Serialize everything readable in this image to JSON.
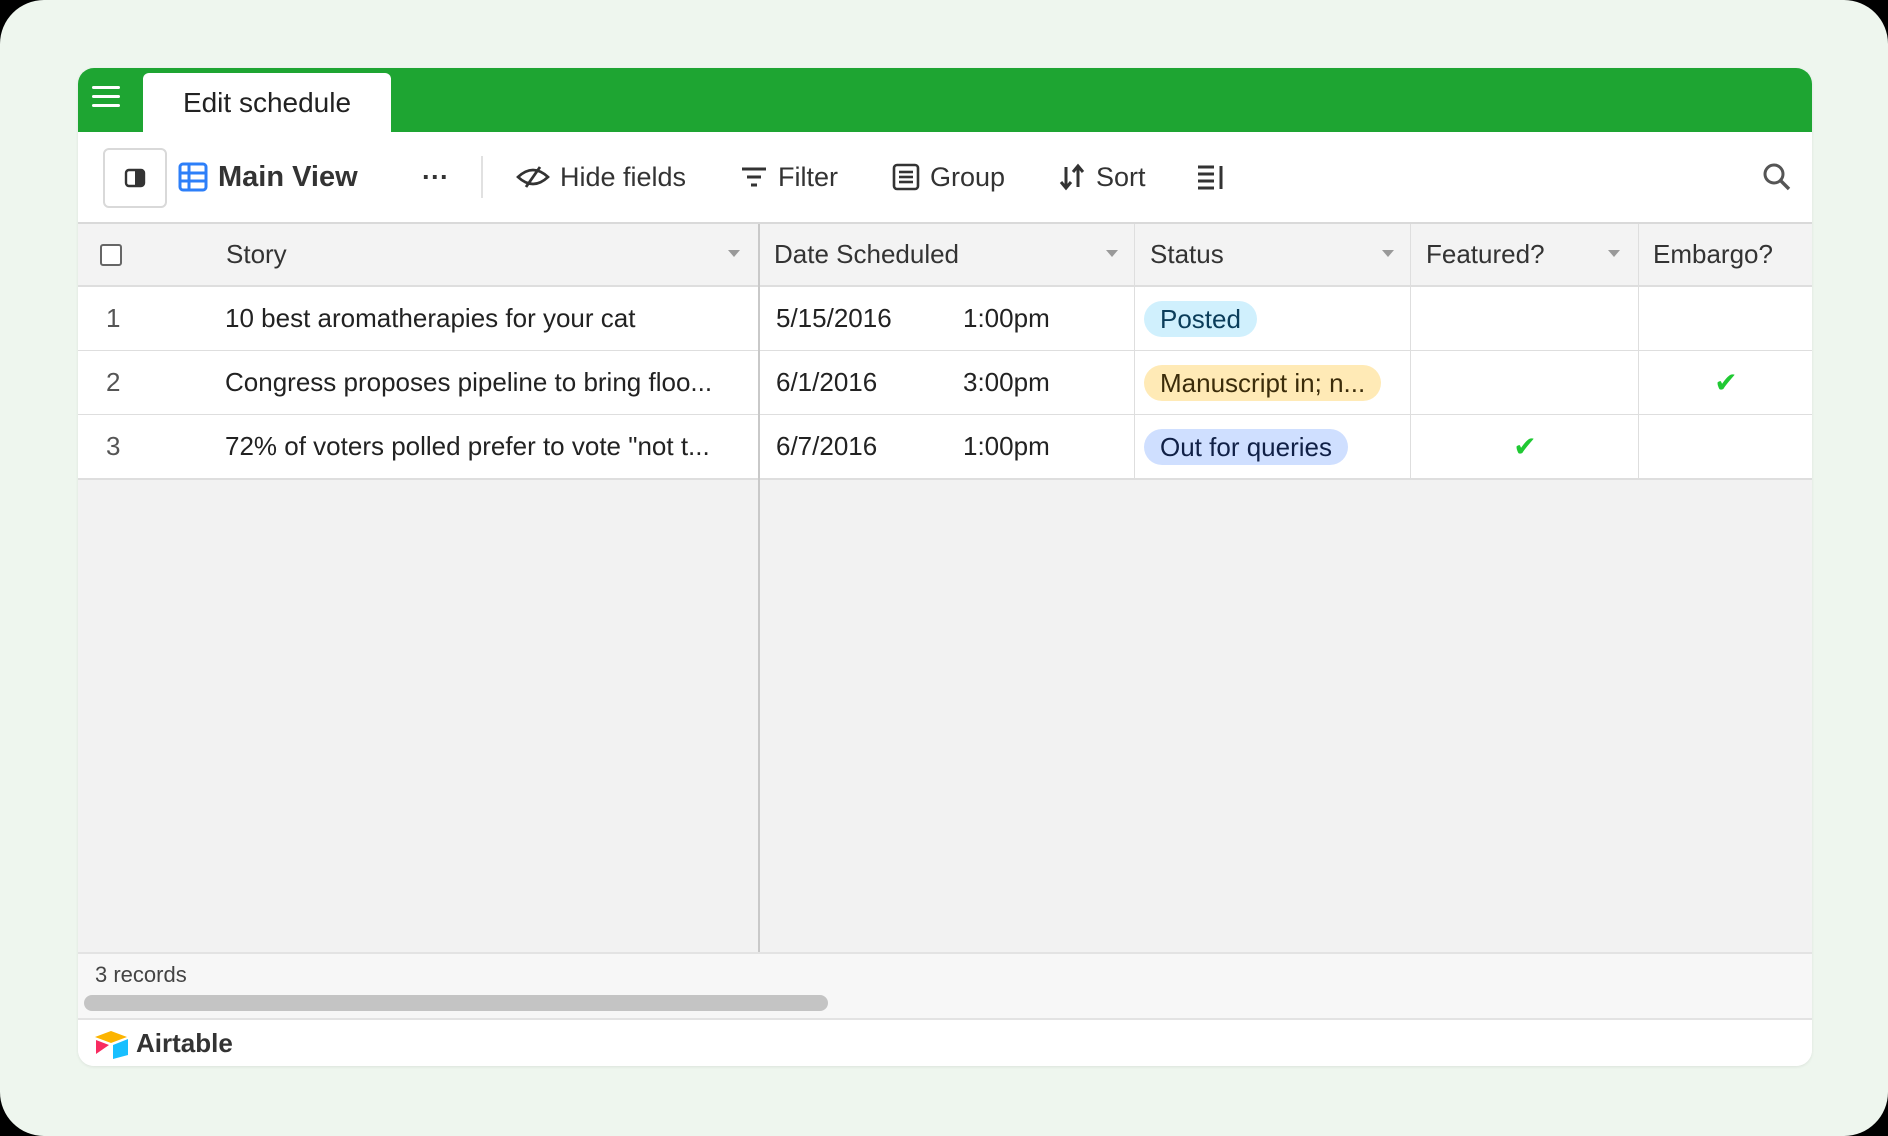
{
  "window": {
    "tab_label": "Edit schedule"
  },
  "toolbar": {
    "view_name": "Main View",
    "more_label": "···",
    "hide_fields": "Hide fields",
    "filter": "Filter",
    "group": "Group",
    "sort": "Sort"
  },
  "columns": [
    "Story",
    "Date Scheduled",
    "Status",
    "Featured?",
    "Embargo?"
  ],
  "rows": [
    {
      "num": "1",
      "story": "10 best aromatherapies for your cat",
      "date": "5/15/2016",
      "time": "1:00pm",
      "status": "Posted",
      "featured": "",
      "embargo": ""
    },
    {
      "num": "2",
      "story": "Congress proposes pipeline to bring floo...",
      "date": "6/1/2016",
      "time": "3:00pm",
      "status": "Manuscript in; n...",
      "featured": "",
      "embargo": "✔"
    },
    {
      "num": "3",
      "story": "72% of voters polled prefer to vote \"not t...",
      "date": "6/7/2016",
      "time": "1:00pm",
      "status": "Out for queries",
      "featured": "✔",
      "embargo": ""
    }
  ],
  "status_colors": {
    "Posted": {
      "bg": "#d0f0fd",
      "fg": "#0b3d5a"
    },
    "Manuscript": {
      "bg": "#ffeab6",
      "fg": "#3b2c0a"
    },
    "Out for queries": {
      "bg": "#cfdfff",
      "fg": "#102046"
    }
  },
  "footer": {
    "records": "3 records",
    "brand": "Airtable"
  }
}
